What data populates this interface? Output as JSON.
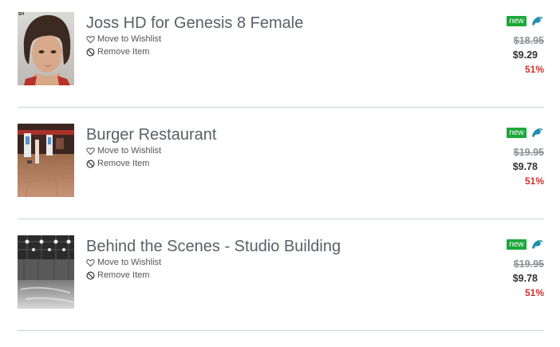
{
  "items": [
    {
      "title": "Joss HD for Genesis 8 Female",
      "wishlist_label": "Move to Wishlist",
      "remove_label": "Remove Item",
      "badge": "new",
      "original_price": "$18.95",
      "sale_price": "$9.29",
      "discount": "51%",
      "thumb_corner_label": "SH"
    },
    {
      "title": "Burger Restaurant",
      "wishlist_label": "Move to Wishlist",
      "remove_label": "Remove Item",
      "badge": "new",
      "original_price": "$19.95",
      "sale_price": "$9.78",
      "discount": "51%"
    },
    {
      "title": "Behind the Scenes - Studio Building",
      "wishlist_label": "Move to Wishlist",
      "remove_label": "Remove Item",
      "badge": "new",
      "original_price": "$19.95",
      "sale_price": "$9.78",
      "discount": "51%"
    }
  ],
  "colors": {
    "badge_green": "#1aa83a",
    "discount_red": "#d0322e",
    "old_price_gray": "#8a9296",
    "brand_icon_teal": "#1f8fb0"
  },
  "icons": {
    "wishlist": "heart-outline-icon",
    "remove": "no-entry-icon",
    "brand": "daz-dragon-icon"
  }
}
